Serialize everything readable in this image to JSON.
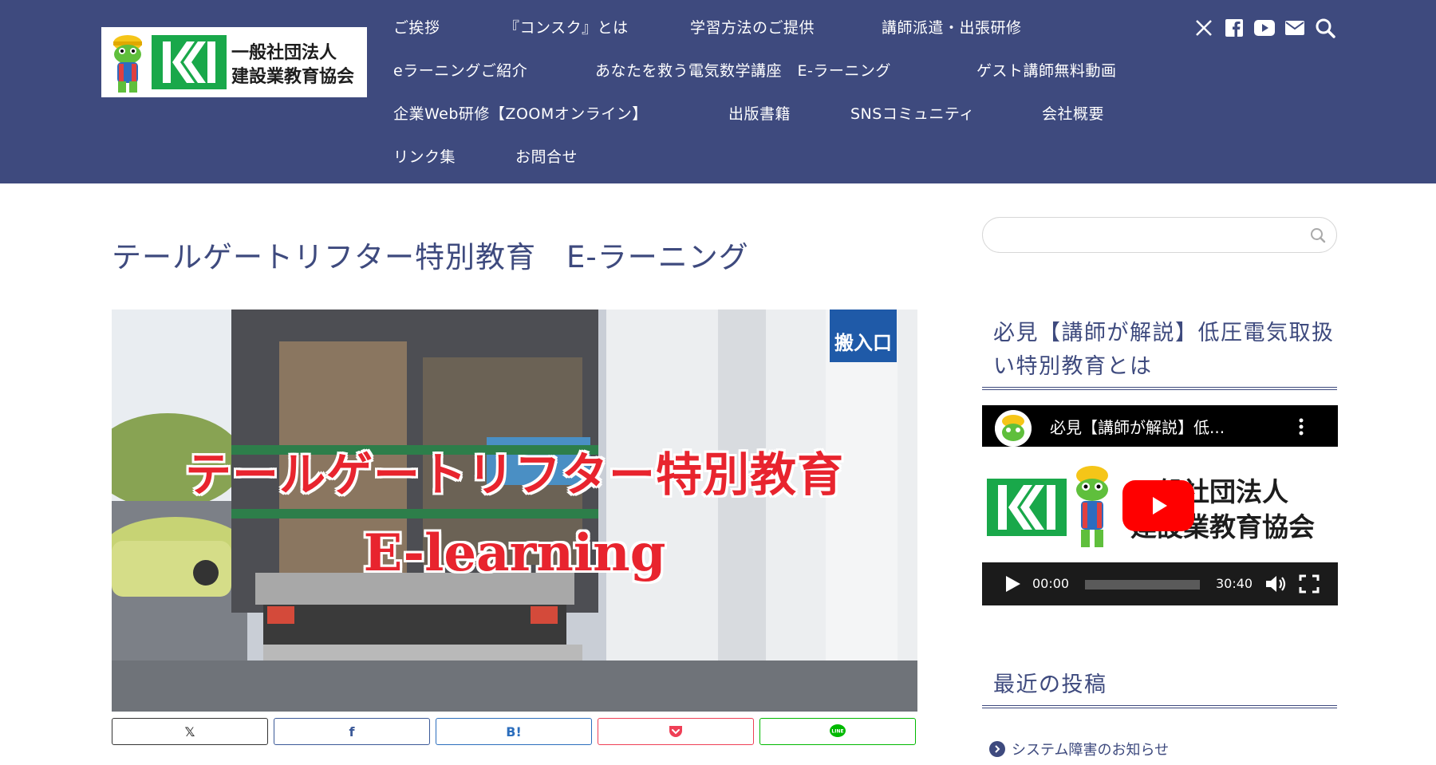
{
  "brand": {
    "logo_line1": "一般社団法人",
    "logo_line2": "建設業教育協会",
    "color_header": "#3e4a7e",
    "color_accent_green": "#19a84a"
  },
  "nav": {
    "items": [
      "ご挨拶",
      "『コンスク』とは",
      "学習方法のご提供",
      "講師派遣・出張研修",
      "eラーニングご紹介",
      "あなたを救う電気数学講座　E-ラーニング",
      "ゲスト講師無料動画",
      "企業Web研修【ZOOMオンライン】",
      "出版書籍",
      "SNSコミュニティ",
      "会社概要",
      "リンク集",
      "お問合せ"
    ]
  },
  "social": {
    "icons": [
      "x-icon",
      "facebook-icon",
      "youtube-icon",
      "mail-icon",
      "search-icon"
    ]
  },
  "article": {
    "title": "テールゲートリフター特別教育　E-ラーニング",
    "hero_line1": "テールゲートリフター特別教育",
    "hero_line2": "E-learning",
    "hero_sign": "搬入口"
  },
  "share": {
    "buttons": [
      {
        "label": "𝕏",
        "color": "#333333"
      },
      {
        "label": "f",
        "color": "#3b5998"
      },
      {
        "label": "B!",
        "color": "#2c6ebd"
      },
      {
        "label": "pocket",
        "color": "#ef3f56"
      },
      {
        "label": "LINE",
        "color": "#00b900"
      }
    ]
  },
  "sidebar": {
    "search_placeholder": "",
    "widget1_title": "必見【講師が解説】低圧電気取扱い特別教育とは",
    "widget2_title": "最近の投稿",
    "video": {
      "title": "必見【講師が解説】低...",
      "thumb_line1": "一般社団法人",
      "thumb_line2": "建設業教育協会",
      "current_time": "00:00",
      "duration": "30:40"
    },
    "recent_posts": [
      "システム障害のお知らせ"
    ]
  }
}
